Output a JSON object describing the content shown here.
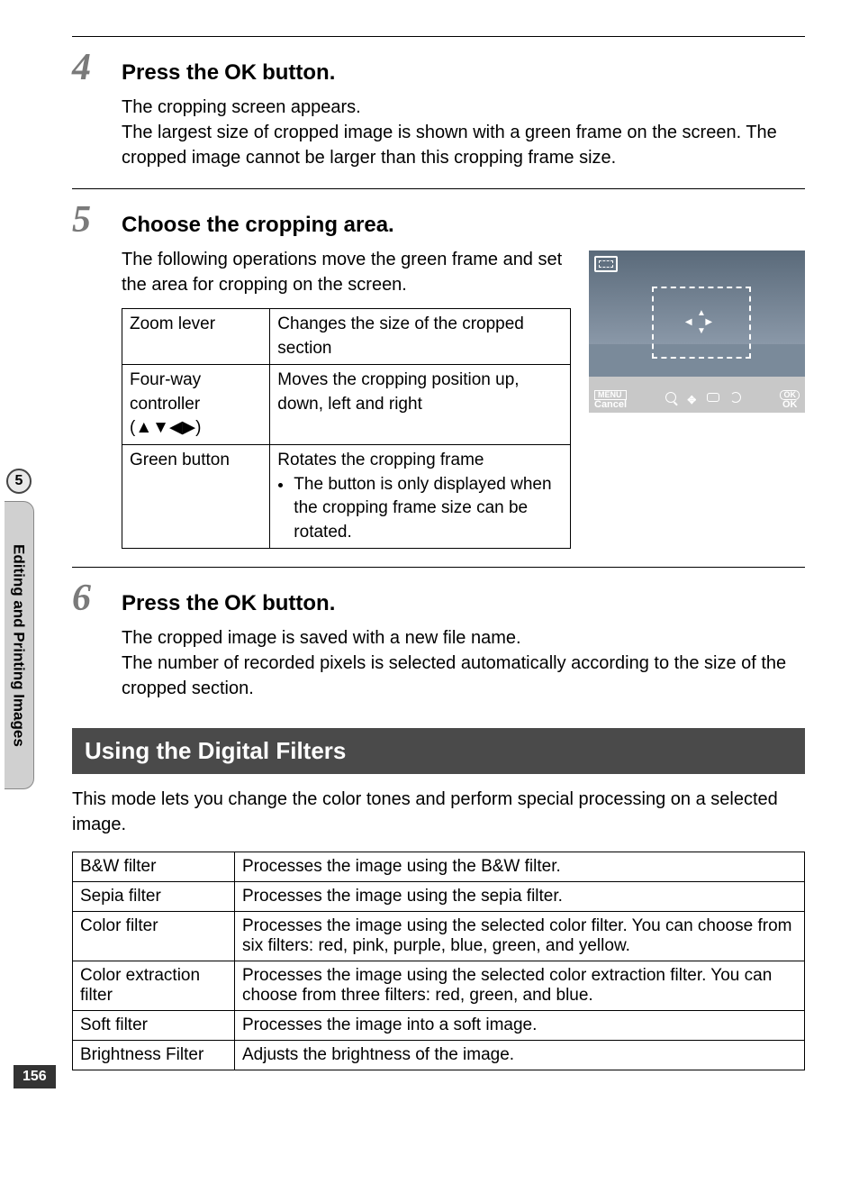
{
  "sideTab": {
    "number": "5",
    "label": "Editing and Printing Images"
  },
  "pageNumber": "156",
  "step4": {
    "number": "4",
    "titlePrefix": "Press the ",
    "titleOk": "OK",
    "titleSuffix": " button.",
    "body1": "The cropping screen appears.",
    "body2": "The largest size of cropped image is shown with a green frame on the screen. The cropped image cannot be larger than this cropping frame size."
  },
  "step5": {
    "number": "5",
    "title": "Choose the cropping area.",
    "intro": "The following operations move the green frame and set the area for cropping on the screen.",
    "table": {
      "r1c1": "Zoom lever",
      "r1c2": "Changes the size of the cropped section",
      "r2c1": "Four-way controller (▲▼◀▶)",
      "r2c2": "Moves the cropping position up, down, left and right",
      "r3c1": "Green button",
      "r3c2a": "Rotates the cropping frame",
      "r3c2b": "The button is only displayed when the cropping frame size can be rotated."
    },
    "preview": {
      "menu": "MENU",
      "cancel": "Cancel",
      "ok": "OK",
      "okBadge": "OK"
    }
  },
  "step6": {
    "number": "6",
    "titlePrefix": "Press the ",
    "titleOk": "OK",
    "titleSuffix": " button.",
    "body1": "The cropped image is saved with a new file name.",
    "body2": "The number of recorded pixels is selected automatically according to the size of the cropped section."
  },
  "filtersSection": {
    "header": "Using the Digital Filters",
    "intro": "This mode lets you change the color tones and perform special processing on a selected image.",
    "rows": [
      {
        "name": "B&W filter",
        "desc": "Processes the image using the B&W filter."
      },
      {
        "name": "Sepia filter",
        "desc": "Processes the image using the sepia filter."
      },
      {
        "name": "Color filter",
        "desc": "Processes the image using the selected color filter. You can choose from six filters: red, pink, purple, blue, green, and yellow."
      },
      {
        "name": "Color extraction filter",
        "desc": "Processes the image using the selected color extraction filter. You can choose from three filters: red, green, and blue."
      },
      {
        "name": "Soft filter",
        "desc": "Processes the image into a soft image."
      },
      {
        "name": "Brightness Filter",
        "desc": "Adjusts the brightness of the image."
      }
    ]
  }
}
